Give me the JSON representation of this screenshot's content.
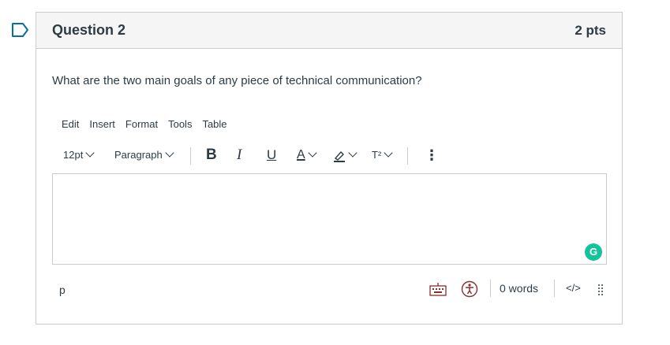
{
  "question": {
    "title": "Question 2",
    "points": "2 pts",
    "text": "What are the two main goals of any piece of technical communication?"
  },
  "menubar": {
    "items": [
      "Edit",
      "Insert",
      "Format",
      "Tools",
      "Table"
    ]
  },
  "toolbar": {
    "font_size": "12pt",
    "block_format": "Paragraph",
    "bold": "B",
    "italic": "I",
    "underline": "U",
    "text_color": "A",
    "superscript": "T²",
    "more": "⋮"
  },
  "statusbar": {
    "path": "p",
    "word_count": "0 words",
    "html_toggle": "</>"
  },
  "grammarly": {
    "label": "G",
    "color": "#15c39a"
  },
  "colors": {
    "flag": "#0770a3",
    "border": "#c7cdd1",
    "text": "#2d3b45"
  }
}
